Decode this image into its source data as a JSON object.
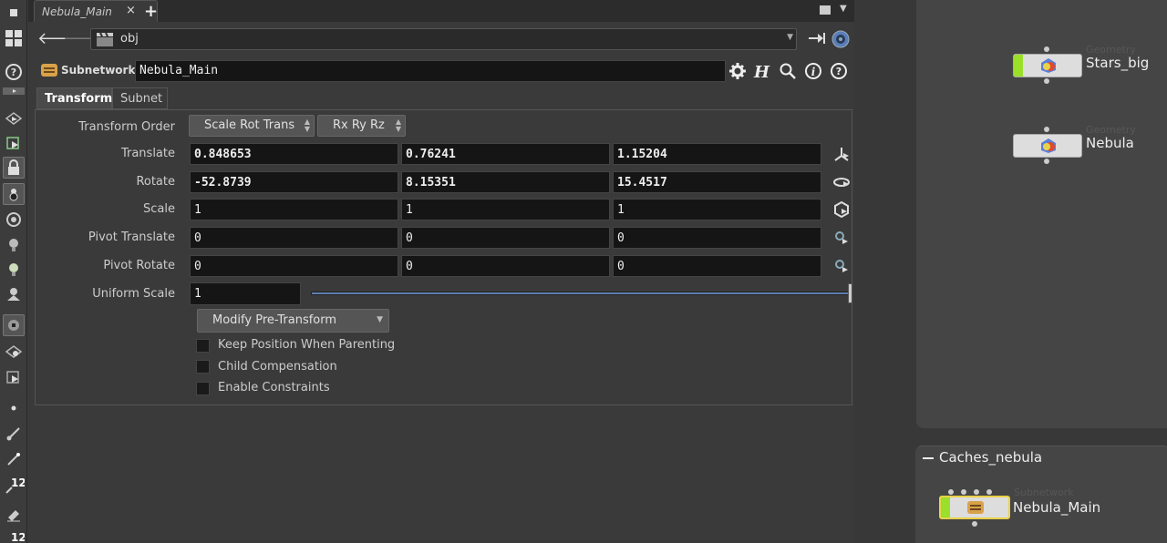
{
  "tab": {
    "label": "Nebula_Main",
    "close": "×",
    "new": "+"
  },
  "path": {
    "value": "obj"
  },
  "operator": {
    "type": "Subnetwork",
    "name": "Nebula_Main"
  },
  "param_tabs": [
    {
      "label": "Transform"
    },
    {
      "label": "Subnet"
    }
  ],
  "params": {
    "transform_order": {
      "label": "Transform Order",
      "order": "Scale Rot Trans",
      "rot": "Rx Ry Rz"
    },
    "translate": {
      "label": "Translate",
      "x": "0.848653",
      "y": "0.76241",
      "z": "1.15204"
    },
    "rotate": {
      "label": "Rotate",
      "x": "-52.8739",
      "y": "8.15351",
      "z": "15.4517"
    },
    "scale": {
      "label": "Scale",
      "x": "1",
      "y": "1",
      "z": "1"
    },
    "pivot_translate": {
      "label": "Pivot Translate",
      "x": "0",
      "y": "0",
      "z": "0"
    },
    "pivot_rotate": {
      "label": "Pivot Rotate",
      "x": "0",
      "y": "0",
      "z": "0"
    },
    "uniform_scale": {
      "label": "Uniform Scale",
      "value": "1",
      "slider_fraction": 1.0
    },
    "modify_menu": {
      "value": "Modify Pre-Transform"
    },
    "checkboxes": [
      {
        "label": "Keep Position When Parenting",
        "checked": false
      },
      {
        "label": "Child Compensation",
        "checked": false
      },
      {
        "label": "Enable Constraints",
        "checked": false
      }
    ]
  },
  "network": {
    "nodes": [
      {
        "type": "Geometry",
        "name": "Stars_big",
        "display_flag": true
      },
      {
        "type": "Geometry",
        "name": "Nebula",
        "display_flag": false
      }
    ],
    "box": {
      "title": "Caches_nebula",
      "node": {
        "type": "Subnetwork",
        "name": "Nebula_Main",
        "display_flag": true
      }
    }
  },
  "toolbar": {
    "badge_1": "12",
    "badge_2": "12"
  },
  "colors": {
    "accent_green": "#9adf2a",
    "slider_blue": "#5d7fb0",
    "node_selected": "#e8d24a"
  }
}
